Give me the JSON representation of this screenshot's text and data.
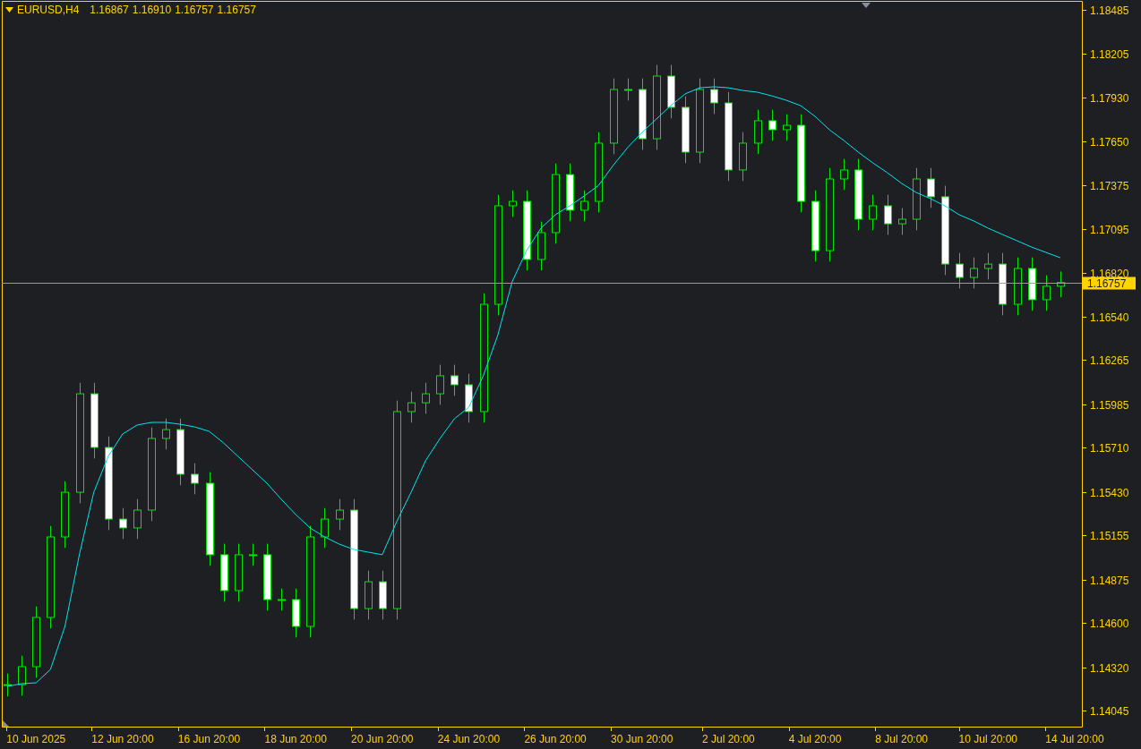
{
  "header": {
    "symbol": "EURUSD,H4",
    "prices": [
      "1.16867",
      "1.16910",
      "1.16757",
      "1.16757"
    ]
  },
  "chart_data": {
    "type": "candlestick",
    "ylim": [
      1.13943,
      1.18547
    ],
    "categories": [
      null,
      null,
      "10 Jun 2025",
      null,
      null,
      null,
      null,
      null,
      "12 Jun 20:00",
      null,
      null,
      null,
      null,
      null,
      "16 Jun 20:00",
      null,
      null,
      null,
      null,
      null,
      "18 Jun 20:00",
      null,
      null,
      null,
      null,
      null,
      "20 Jun 20:00",
      null,
      null,
      null,
      null,
      null,
      "24 Jun 20:00",
      null,
      null,
      null,
      null,
      null,
      "26 Jun 20:00",
      null,
      null,
      null,
      null,
      null,
      "30 Jun 20:00",
      null,
      null,
      null,
      null,
      null,
      "2 Jul 20:00",
      null,
      null,
      null,
      null,
      null,
      "4 Jul 20:00",
      null,
      null,
      null,
      null,
      null,
      "8 Jul 20:00",
      null,
      null,
      null,
      null,
      null,
      "10 Jul 20:00",
      null,
      null,
      null,
      null,
      null,
      "14 Jul 20:00"
    ],
    "yticks": [
      {
        "value": 1.18485,
        "label": "1.18485"
      },
      {
        "value": 1.18205,
        "label": "1.18205"
      },
      {
        "value": 1.1793,
        "label": "1.17930"
      },
      {
        "value": 1.1765,
        "label": "1.17650"
      },
      {
        "value": 1.17375,
        "label": "1.17375"
      },
      {
        "value": 1.17095,
        "label": "1.17095"
      },
      {
        "value": 1.1682,
        "label": "1.16820"
      },
      {
        "value": 1.1654,
        "label": "1.16540"
      },
      {
        "value": 1.16265,
        "label": "1.16265"
      },
      {
        "value": 1.15985,
        "label": "1.15985"
      },
      {
        "value": 1.1571,
        "label": "1.15710"
      },
      {
        "value": 1.1543,
        "label": "1.15430"
      },
      {
        "value": 1.15155,
        "label": "1.15155"
      },
      {
        "value": 1.14875,
        "label": "1.14875"
      },
      {
        "value": 1.146,
        "label": "1.14600"
      },
      {
        "value": 1.1432,
        "label": "1.14320"
      },
      {
        "value": 1.14045,
        "label": "1.14045"
      }
    ],
    "ohlc": [
      [
        1.14204,
        1.14279,
        1.14134,
        1.14209
      ],
      [
        1.14209,
        1.14393,
        1.14139,
        1.14323
      ],
      [
        1.14323,
        1.14705,
        1.14253,
        1.14635
      ],
      [
        1.14635,
        1.15215,
        1.14565,
        1.15145
      ],
      [
        1.15145,
        1.15498,
        1.15075,
        1.15428
      ],
      [
        1.15428,
        1.16122,
        1.15358,
        1.16052
      ],
      [
        1.16052,
        1.16122,
        1.15642,
        1.15712
      ],
      [
        1.15712,
        1.15782,
        1.15188,
        1.15258
      ],
      [
        1.15258,
        1.15328,
        1.15132,
        1.15202
      ],
      [
        1.15202,
        1.15385,
        1.15132,
        1.15315
      ],
      [
        1.15315,
        1.15839,
        1.15245,
        1.15769
      ],
      [
        1.15769,
        1.15895,
        1.15699,
        1.15825
      ],
      [
        1.15825,
        1.15895,
        1.15472,
        1.15542
      ],
      [
        1.15542,
        1.15612,
        1.15415,
        1.15485
      ],
      [
        1.15485,
        1.15555,
        1.14962,
        1.15032
      ],
      [
        1.15032,
        1.15102,
        1.14735,
        1.14805
      ],
      [
        1.14805,
        1.15102,
        1.14735,
        1.15032
      ],
      [
        1.15032,
        1.15102,
        1.14962,
        1.15032
      ],
      [
        1.15032,
        1.15102,
        1.14678,
        1.14748
      ],
      [
        1.14748,
        1.14818,
        1.14678,
        1.14748
      ],
      [
        1.14748,
        1.14818,
        1.14508,
        1.14578
      ],
      [
        1.14578,
        1.15215,
        1.14508,
        1.15145
      ],
      [
        1.15145,
        1.15328,
        1.15075,
        1.15258
      ],
      [
        1.15258,
        1.15385,
        1.15188,
        1.15315
      ],
      [
        1.15315,
        1.15385,
        1.14621,
        1.14691
      ],
      [
        1.14691,
        1.14931,
        1.14621,
        1.14861
      ],
      [
        1.14861,
        1.14931,
        1.14621,
        1.14691
      ],
      [
        1.14691,
        1.16009,
        1.14621,
        1.15939
      ],
      [
        1.15939,
        1.16065,
        1.15869,
        1.15995
      ],
      [
        1.15995,
        1.16122,
        1.15925,
        1.16052
      ],
      [
        1.16052,
        1.16236,
        1.15982,
        1.16166
      ],
      [
        1.16166,
        1.16236,
        1.16039,
        1.16109
      ],
      [
        1.16109,
        1.16179,
        1.15869,
        1.15939
      ],
      [
        1.15939,
        1.16689,
        1.15869,
        1.16619
      ],
      [
        1.16619,
        1.17313,
        1.16549,
        1.17243
      ],
      [
        1.17243,
        1.17341,
        1.17173,
        1.17271
      ],
      [
        1.17271,
        1.17341,
        1.16833,
        1.16903
      ],
      [
        1.16903,
        1.17143,
        1.16833,
        1.17073
      ],
      [
        1.17073,
        1.17511,
        1.17003,
        1.17441
      ],
      [
        1.17441,
        1.17511,
        1.17145,
        1.17215
      ],
      [
        1.17215,
        1.17341,
        1.17145,
        1.17271
      ],
      [
        1.17271,
        1.1771,
        1.17201,
        1.1764
      ],
      [
        1.1764,
        1.1805,
        1.1757,
        1.1798
      ],
      [
        1.1798,
        1.1805,
        1.1791,
        1.1798
      ],
      [
        1.1798,
        1.1805,
        1.17598,
        1.17668
      ],
      [
        1.17668,
        1.18135,
        1.17598,
        1.18065
      ],
      [
        1.18065,
        1.18135,
        1.17797,
        1.17867
      ],
      [
        1.17867,
        1.17937,
        1.17513,
        1.17583
      ],
      [
        1.17583,
        1.1805,
        1.17513,
        1.1798
      ],
      [
        1.1798,
        1.1805,
        1.17825,
        1.17895
      ],
      [
        1.17895,
        1.17965,
        1.174,
        1.1747
      ],
      [
        1.1747,
        1.1771,
        1.174,
        1.1764
      ],
      [
        1.1764,
        1.17852,
        1.1757,
        1.17782
      ],
      [
        1.17782,
        1.17852,
        1.17655,
        1.17725
      ],
      [
        1.17725,
        1.17823,
        1.17655,
        1.17753
      ],
      [
        1.17753,
        1.17823,
        1.17201,
        1.17271
      ],
      [
        1.17271,
        1.17341,
        1.16889,
        1.16959
      ],
      [
        1.16959,
        1.17483,
        1.16889,
        1.17413
      ],
      [
        1.17413,
        1.1754,
        1.17343,
        1.1747
      ],
      [
        1.1747,
        1.1754,
        1.17088,
        1.17158
      ],
      [
        1.17158,
        1.17313,
        1.17088,
        1.17243
      ],
      [
        1.17243,
        1.17313,
        1.17059,
        1.17129
      ],
      [
        1.17129,
        1.17228,
        1.17059,
        1.17158
      ],
      [
        1.17158,
        1.17483,
        1.17088,
        1.17413
      ],
      [
        1.17413,
        1.17483,
        1.1723,
        1.173
      ],
      [
        1.173,
        1.1737,
        1.16804,
        1.16874
      ],
      [
        1.16874,
        1.16944,
        1.16719,
        1.16789
      ],
      [
        1.16789,
        1.16916,
        1.16719,
        1.16846
      ],
      [
        1.16846,
        1.16944,
        1.16776,
        1.16874
      ],
      [
        1.16874,
        1.16944,
        1.16549,
        1.16619
      ],
      [
        1.16619,
        1.16916,
        1.16549,
        1.16846
      ],
      [
        1.16846,
        1.16916,
        1.16578,
        1.16648
      ],
      [
        1.16648,
        1.16803,
        1.16578,
        1.16733
      ],
      [
        1.16733,
        1.16827,
        1.16663,
        1.16757
      ],
      null
    ],
    "series": [
      {
        "type": "line",
        "color": "#00e5ee",
        "values": [
          1.14198,
          1.14215,
          1.14221,
          1.14306,
          1.14578,
          1.15032,
          1.15428,
          1.15655,
          1.15797,
          1.15854,
          1.15871,
          1.15871,
          1.15859,
          1.15842,
          1.15814,
          1.1574,
          1.15655,
          1.1557,
          1.15485,
          1.15383,
          1.15287,
          1.15202,
          1.15145,
          1.151,
          1.15066,
          1.15049,
          1.15032,
          1.15241,
          1.15428,
          1.15627,
          1.15769,
          1.15894,
          1.15967,
          1.16166,
          1.16421,
          1.16761,
          1.16959,
          1.17101,
          1.17186,
          1.17243,
          1.17305,
          1.17373,
          1.17498,
          1.17611,
          1.17708,
          1.17793,
          1.17878,
          1.17952,
          1.17991,
          1.17997,
          1.17991,
          1.17974,
          1.17963,
          1.1794,
          1.17912,
          1.17878,
          1.1781,
          1.17725,
          1.17657,
          1.17583,
          1.17515,
          1.17453,
          1.17385,
          1.17328,
          1.17288,
          1.17243,
          1.17186,
          1.17147,
          1.17101,
          1.17061,
          1.17022,
          1.16982,
          1.16948,
          1.16914,
          null
        ]
      }
    ],
    "ref_lines": [
      {
        "axis": "y",
        "value": 1.16757,
        "label": "1.16757",
        "color": "#9a9a9a"
      }
    ]
  }
}
